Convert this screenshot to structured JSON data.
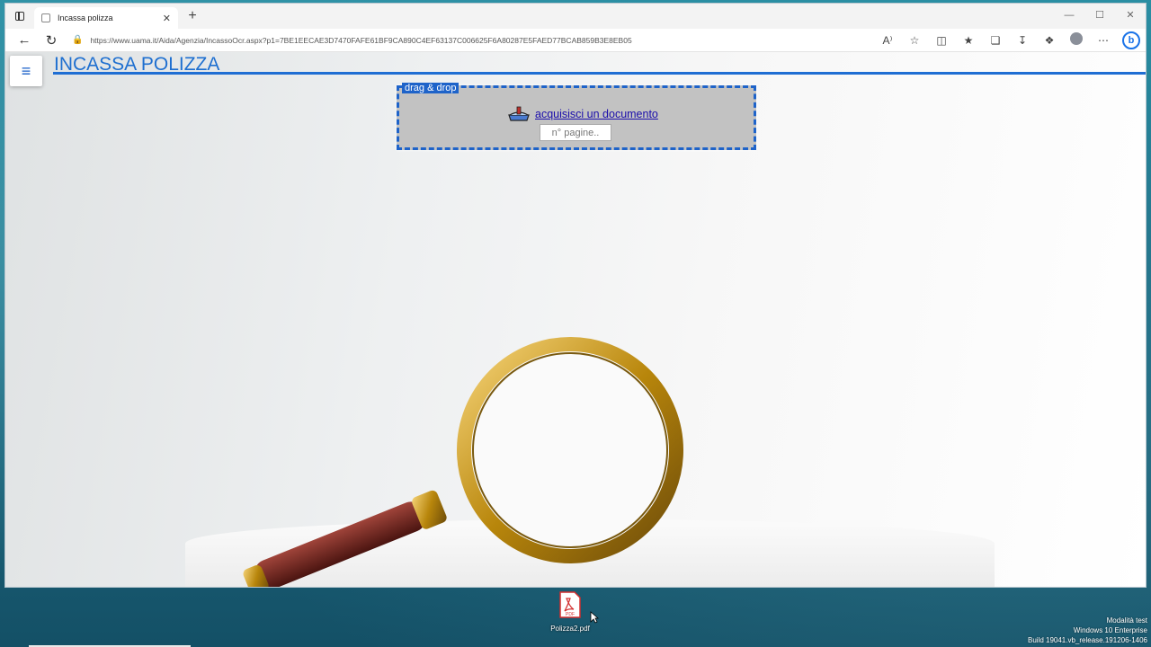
{
  "browser": {
    "tab_title": "Incassa polizza",
    "tab_close": "✕",
    "new_tab": "+",
    "url": "https://www.uama.it/Aida/Agenzia/IncassoOcr.aspx?p1=7BE1EECAE3D7470FAFE61BF9CA890C4EF63137C006625F6A80287E5FAED77BCAB859B3E8EB05",
    "window_controls": [
      "—",
      "☐",
      "✕"
    ],
    "read_aloud": "A⁾"
  },
  "page": {
    "title": "INCASSA POLIZZA",
    "menu_icon": "≡",
    "dropzone": {
      "label": "drag & drop",
      "link_text": "acquisisci un documento",
      "pages_placeholder": "n° pagine.."
    }
  },
  "desktop": {
    "file_name": "Polizza2.pdf",
    "pdf_badge": "PDF",
    "watermark": [
      "Modalità test",
      "Windows 10 Enterprise",
      "Build 19041.vb_release.191206-1406"
    ]
  },
  "colors": {
    "accent": "#1e6fd0",
    "dropzone_border": "#1e63c9",
    "dropzone_bg": "#c2c2c2",
    "link": "#1a0dab"
  }
}
